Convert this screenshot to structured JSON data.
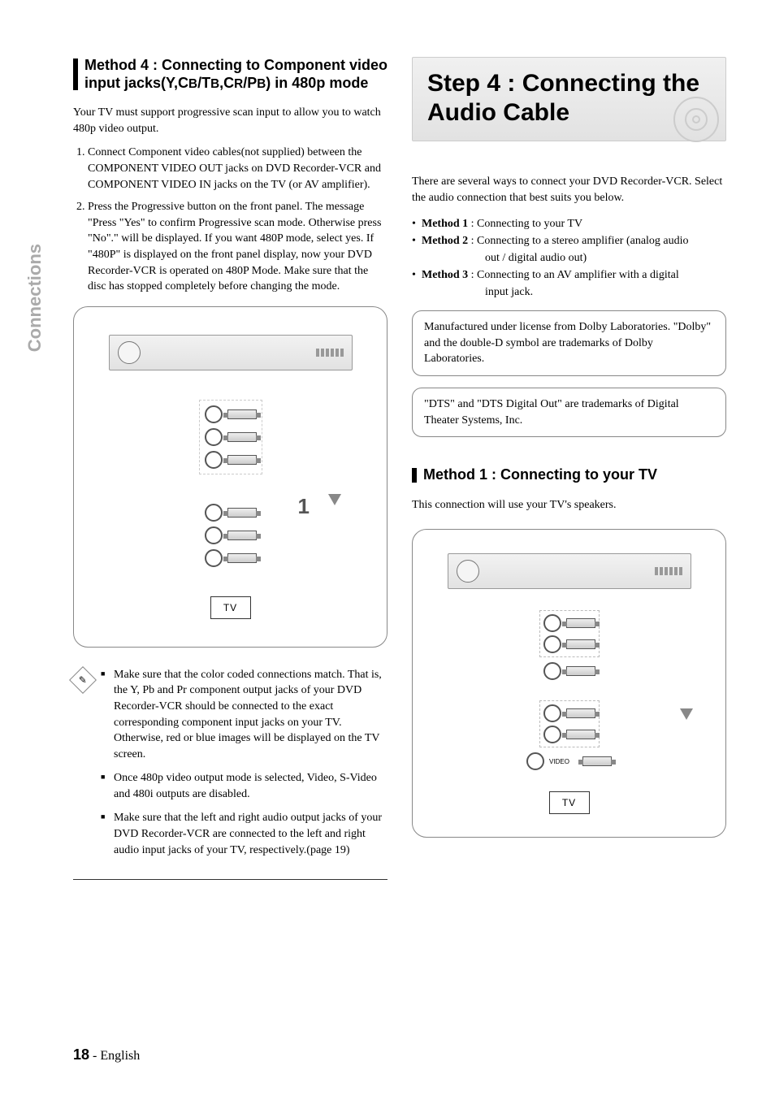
{
  "side_tab": "Connections",
  "left": {
    "heading_pre": "Method 4 : Connecting to Component video input jacks(Y,C",
    "heading_b1": "B",
    "heading_mid1": "/T",
    "heading_b2": "B",
    "heading_mid2": ",C",
    "heading_b3": "R",
    "heading_mid3": "/P",
    "heading_b4": "B",
    "heading_post": ") in 480p mode",
    "intro": "Your TV must support progressive scan input to allow you to watch 480p video output.",
    "steps": [
      "Connect Component video cables(not supplied) between the COMPONENT VIDEO OUT jacks on DVD Recorder-VCR and COMPONENT VIDEO IN jacks on the TV (or AV amplifier).",
      "Press the Progressive button on the front panel. The message \"Press \"Yes\" to confirm Progressive scan mode. Otherwise press \"No\".\" will be displayed. If you want 480P mode, select yes. If \"480P\" is displayed on the front panel display, now your DVD Recorder-VCR is operated on 480P Mode. Make sure that the disc has stopped completely before changing the mode."
    ],
    "diagram_num": "1",
    "tv_label": "TV",
    "notes": [
      "Make sure that the color coded connections match. That is, the Y, Pb and Pr component output jacks of your DVD Recorder-VCR should be connected to the exact corresponding component input jacks on your TV. Otherwise, red or blue images will be displayed on the TV screen.",
      "Once 480p video output mode is selected, Video, S-Video and 480i outputs are disabled.",
      "Make sure that the left and right audio output jacks of your DVD Recorder-VCR are connected to the left and right audio input jacks of your TV, respectively.(page 19)"
    ]
  },
  "right": {
    "banner": "Step 4 : Connecting the Audio Cable",
    "intro": "There are several ways to connect your DVD Recorder-VCR. Select the audio connection that best suits you below.",
    "methods": [
      {
        "label": "Method 1",
        "text": " : Connecting to your TV"
      },
      {
        "label": "Method 2",
        "text": " : Connecting to a stereo amplifier (analog audio",
        "cont": "out / digital audio out)"
      },
      {
        "label": "Method 3",
        "text": " : Connecting to an AV amplifier with a digital",
        "cont": "input jack."
      }
    ],
    "box1": "Manufactured under license from Dolby Laboratories. \"Dolby\" and the double-D symbol are trademarks of Dolby Laboratories.",
    "box2": "\"DTS\" and \"DTS Digital Out\" are trademarks of Digital Theater Systems, Inc.",
    "m1_heading": "Method 1 : Connecting to your TV",
    "m1_text": "This connection will use your TV's speakers.",
    "tv_label": "TV",
    "video_label": "VIDEO"
  },
  "footer": {
    "page": "18",
    "lang": "English"
  }
}
